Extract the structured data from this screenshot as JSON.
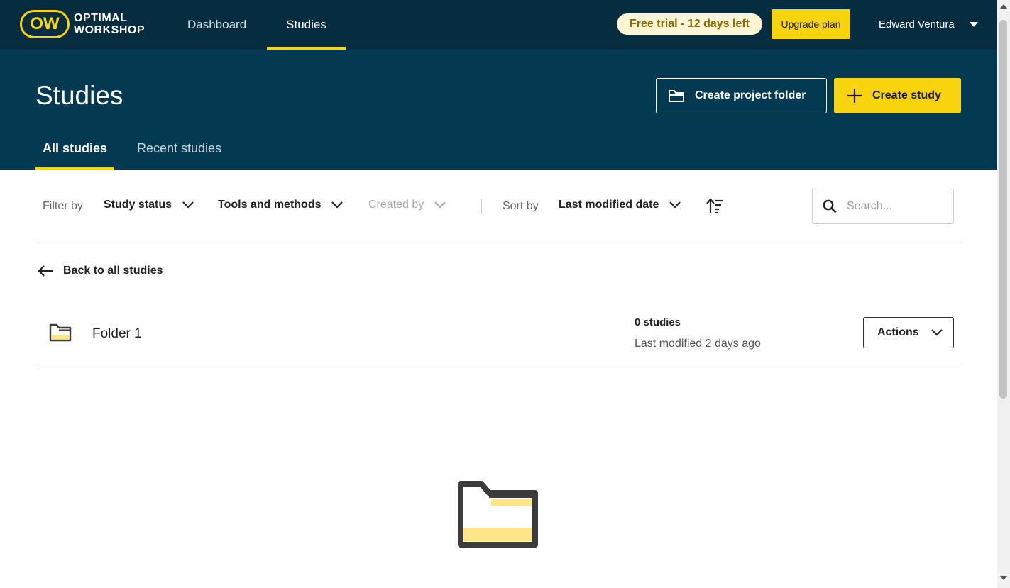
{
  "brand": {
    "logo_mark": "OW",
    "logo_line1": "OPTIMAL",
    "logo_line2": "WORKSHOP",
    "accent": "#f8d40e",
    "nav_bg": "#052c3f",
    "header_bg": "#033a52"
  },
  "topnav": {
    "links": [
      {
        "label": "Dashboard"
      },
      {
        "label": "Studies",
        "active": true
      }
    ],
    "trial_badge": "Free trial - 12 days left",
    "upgrade_label": "Upgrade plan",
    "user_name": "Edward Ventura"
  },
  "header": {
    "title": "Studies",
    "create_folder_label": "Create project folder",
    "create_study_label": "Create study",
    "tabs": [
      {
        "label": "All studies",
        "active": true
      },
      {
        "label": "Recent studies"
      }
    ]
  },
  "filters": {
    "filter_by_label": "Filter by",
    "study_status": "Study status",
    "tools_methods": "Tools and methods",
    "created_by": "Created by",
    "sort_by_label": "Sort by",
    "sort_value": "Last modified date",
    "search_placeholder": "Search..."
  },
  "back_link": "Back to all studies",
  "folder": {
    "name": "Folder 1",
    "count": "0 studies",
    "modified": "Last modified 2 days ago",
    "actions_label": "Actions"
  }
}
